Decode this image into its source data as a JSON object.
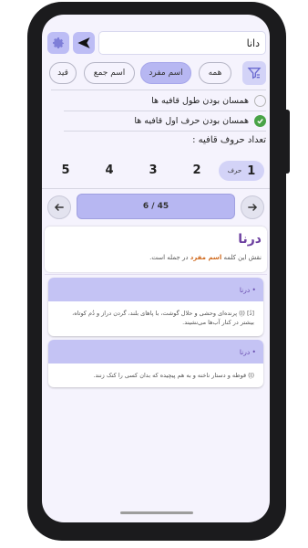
{
  "search": {
    "value": "دانا"
  },
  "chips": [
    {
      "label": "قید",
      "active": false
    },
    {
      "label": "اسم جمع",
      "active": false
    },
    {
      "label": "اسم مفرد",
      "active": true
    },
    {
      "label": "همه",
      "active": false
    }
  ],
  "checks": [
    {
      "label": "همسان بودن طول قافیه ها",
      "checked": false
    },
    {
      "label": "همسان بودن حرف اول قافیه ها",
      "checked": true
    }
  ],
  "count_title": "تعداد حروف قافیه :",
  "numbers": [
    "5",
    "4",
    "3",
    "2"
  ],
  "selected_number": {
    "value": "1",
    "unit": "حرف"
  },
  "pager": {
    "text": "6 / 45"
  },
  "word": {
    "title": "درنا",
    "role_prefix": "نقش این کلمه",
    "role_highlight": "اسم مفرد",
    "role_suffix": "در جمله است."
  },
  "meanings": [
    {
      "title": "• درنا",
      "text": "[دُ] (اِ) پرنده‌ای وحشی و حلال گوشت، با پاهای بلند، گردن دراز و دُم کوتاه، بیشتر در کنار آب‌ها می‌نشیند."
    },
    {
      "title": "• درنا",
      "text": "(اِ) قوطه و دستار ناخنه و به هم پیچیده که بدان کسی را کتک زنند."
    }
  ],
  "icons": {
    "gear": "gear-icon",
    "send": "send-arrow-icon",
    "filter": "filter-icon",
    "prev": "arrow-left-icon",
    "next": "arrow-right-icon"
  },
  "colors": {
    "accent": "#b7b7f2",
    "check_on": "#49a347",
    "word_title": "#6c3fa0",
    "highlight": "#d06a1e"
  }
}
